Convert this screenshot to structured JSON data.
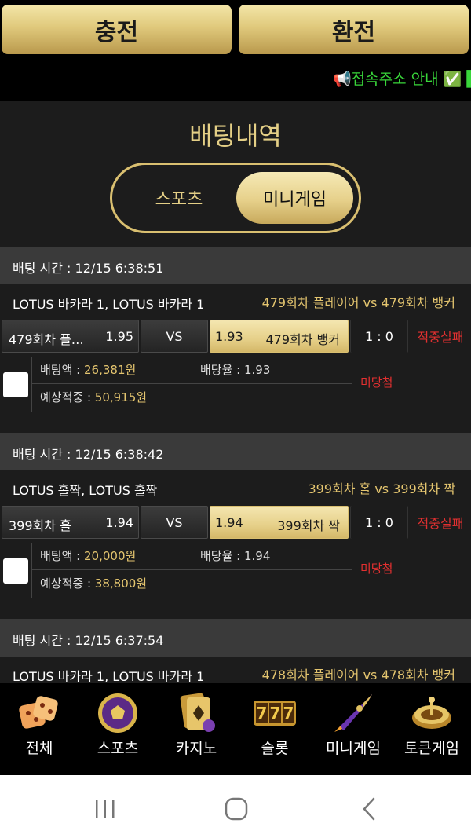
{
  "header": {
    "charge_label": "충전",
    "exchange_label": "환전"
  },
  "marquee": {
    "text": "📢접속주소 안내 ✅ ▌"
  },
  "history": {
    "title": "배팅내역",
    "tabs": {
      "sports": "스포츠",
      "mini": "미니게임"
    },
    "bets": [
      {
        "time": "배팅 시간 : 12/15 6:38:51",
        "game": "LOTUS 바카라 1, LOTUS 바카라 1",
        "matchup": "479회차 플레이어  vs  479회차 뱅커",
        "home_label": "479회차 플레…",
        "home_odd": "1.95",
        "vs": "VS",
        "away_odd": "1.93",
        "away_label": "479회차 뱅커",
        "score": "1 : 0",
        "result": "적중실패",
        "amount_label": "배팅액 : ",
        "amount": "26,381원",
        "odds_label": "배당율 : 1.93",
        "expected_label": "예상적중 : ",
        "expected": "50,915원",
        "status": "미당첨"
      },
      {
        "time": "배팅 시간 : 12/15 6:38:42",
        "game": "LOTUS 홀짝, LOTUS 홀짝",
        "matchup": "399회차 홀  vs  399회차 짝",
        "home_label": "399회차 홀",
        "home_odd": "1.94",
        "vs": "VS",
        "away_odd": "1.94",
        "away_label": "399회차 짝",
        "score": "1 : 0",
        "result": "적중실패",
        "amount_label": "배팅액 : ",
        "amount": "20,000원",
        "odds_label": "배당율 : 1.94",
        "expected_label": "예상적중 : ",
        "expected": "38,800원",
        "status": "미당첨"
      },
      {
        "time": "배팅 시간 : 12/15 6:37:54",
        "game": "LOTUS 바카라 1, LOTUS 바카라 1",
        "matchup": "478회차 플레이어  vs  478회차 뱅커"
      }
    ]
  },
  "categories": [
    {
      "label": "전체",
      "icon": "dice-icon"
    },
    {
      "label": "스포츠",
      "icon": "soccer-ball-icon"
    },
    {
      "label": "카지노",
      "icon": "cards-icon"
    },
    {
      "label": "슬롯",
      "icon": "slot-777-icon"
    },
    {
      "label": "미니게임",
      "icon": "rocket-icon"
    },
    {
      "label": "토큰게임",
      "icon": "roulette-icon"
    }
  ],
  "colors": {
    "gold": "#e4c56f",
    "fail_red": "#e23030",
    "marquee_green": "#39d63a"
  }
}
